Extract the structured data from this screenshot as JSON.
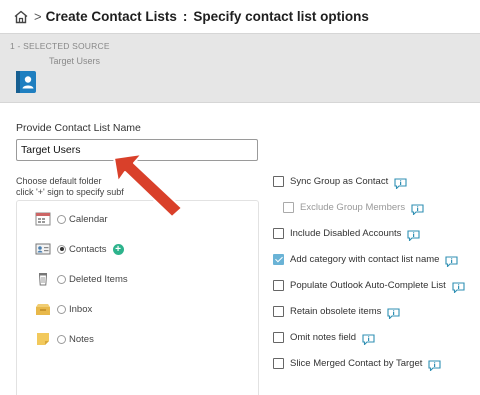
{
  "breadcrumb": {
    "title": "Create Contact Lists",
    "separator": ">",
    "colon": ":",
    "subtitle": "Specify contact list options"
  },
  "source": {
    "step_label": "1 - SELECTED SOURCE",
    "name": "Target Users"
  },
  "contact_list": {
    "name_label": "Provide Contact List Name",
    "name_value": "Target Users"
  },
  "folder": {
    "hint_line1": "Choose default folder",
    "hint_line2": "click '+' sign to specify subf",
    "items": [
      {
        "label": "Calendar",
        "icon": "calendar-icon",
        "selected": false
      },
      {
        "label": "Contacts",
        "icon": "contacts-icon",
        "selected": true
      },
      {
        "label": "Deleted Items",
        "icon": "trash-icon",
        "selected": false
      },
      {
        "label": "Inbox",
        "icon": "inbox-icon",
        "selected": false
      },
      {
        "label": "Notes",
        "icon": "notes-icon",
        "selected": false
      }
    ],
    "add_symbol": "+"
  },
  "options": [
    {
      "label": "Sync Group as Contact",
      "checked": false,
      "disabled": false
    },
    {
      "label": "Exclude Group Members",
      "checked": false,
      "disabled": true
    },
    {
      "label": "Include Disabled Accounts",
      "checked": false,
      "disabled": false
    },
    {
      "label": "Add category with contact list name",
      "checked": true,
      "disabled": false
    },
    {
      "label": "Populate Outlook Auto-Complete List",
      "checked": false,
      "disabled": false
    },
    {
      "label": "Retain obsolete items",
      "checked": false,
      "disabled": false
    },
    {
      "label": "Omit notes field",
      "checked": false,
      "disabled": false
    },
    {
      "label": "Slice Merged Contact by Target",
      "checked": false,
      "disabled": false
    }
  ],
  "colors": {
    "accent": "#2db38c",
    "checked": "#6ab3d6",
    "info": "#2f8fb3",
    "arrow": "#d9402a",
    "source_icon": "#1f7fc0"
  }
}
